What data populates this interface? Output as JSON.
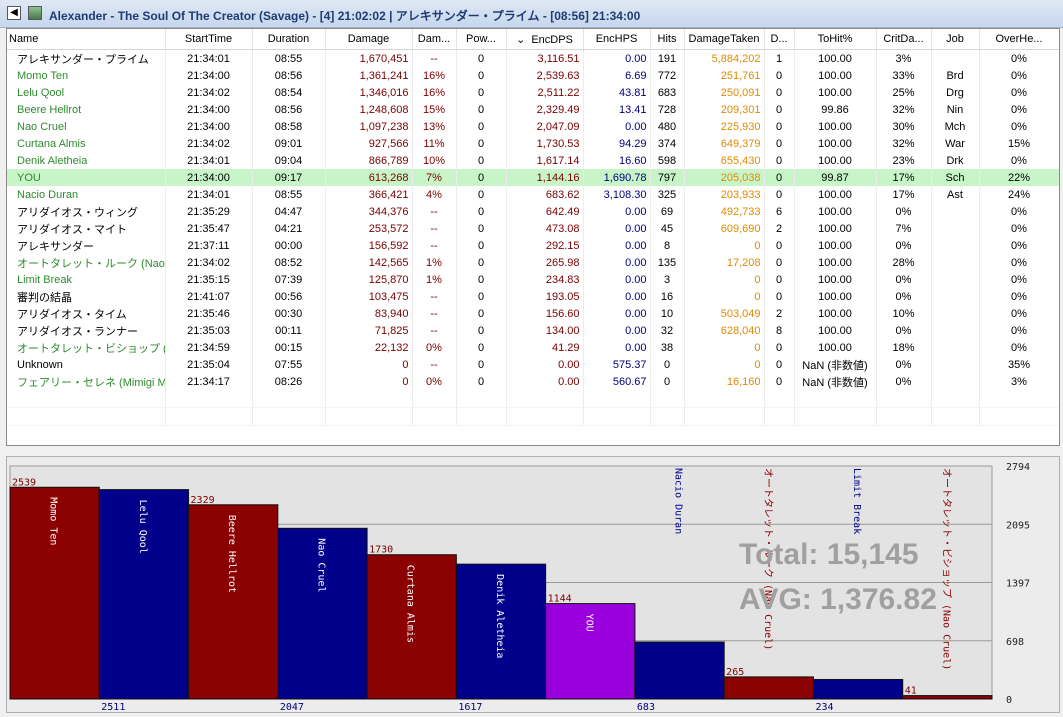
{
  "window": {
    "title": "Alexander - The Soul Of The Creator (Savage) - [4] 21:02:02 | アレキサンダー・プライム - [08:56] 21:34:00"
  },
  "table": {
    "columns": [
      {
        "key": "name",
        "label": "Name"
      },
      {
        "key": "start",
        "label": "StartTime"
      },
      {
        "key": "dur",
        "label": "Duration"
      },
      {
        "key": "dmg",
        "label": "Damage"
      },
      {
        "key": "dmgp",
        "label": "Dam..."
      },
      {
        "key": "pow",
        "label": "Pow..."
      },
      {
        "key": "encdps",
        "label": "EncDPS",
        "sort": "⌄"
      },
      {
        "key": "enchps",
        "label": "EncHPS"
      },
      {
        "key": "hits",
        "label": "Hits"
      },
      {
        "key": "taken",
        "label": "DamageTaken"
      },
      {
        "key": "d",
        "label": "D..."
      },
      {
        "key": "tohit",
        "label": "ToHit%"
      },
      {
        "key": "crit",
        "label": "CritDa..."
      },
      {
        "key": "job",
        "label": "Job"
      },
      {
        "key": "over",
        "label": "OverHe..."
      }
    ],
    "rows": [
      {
        "name": "アレキサンダー・プライム",
        "start": "21:34:01",
        "dur": "08:55",
        "dmg": "1,670,451",
        "dmgp": "--",
        "pow": "0",
        "encdps": "3,116.51",
        "enchps": "0.00",
        "hits": "191",
        "taken": "5,884,202",
        "d": "1",
        "tohit": "100.00",
        "crit": "3%",
        "job": "",
        "over": "0%",
        "color": "black"
      },
      {
        "name": "Momo Ten",
        "start": "21:34:00",
        "dur": "08:56",
        "dmg": "1,361,241",
        "dmgp": "16%",
        "pow": "0",
        "encdps": "2,539.63",
        "enchps": "6.69",
        "hits": "772",
        "taken": "251,761",
        "d": "0",
        "tohit": "100.00",
        "crit": "33%",
        "job": "Brd",
        "over": "0%",
        "color": "green"
      },
      {
        "name": "Lelu Qool",
        "start": "21:34:02",
        "dur": "08:54",
        "dmg": "1,346,016",
        "dmgp": "16%",
        "pow": "0",
        "encdps": "2,511.22",
        "enchps": "43.81",
        "hits": "683",
        "taken": "250,091",
        "d": "0",
        "tohit": "100.00",
        "crit": "25%",
        "job": "Drg",
        "over": "0%",
        "color": "green"
      },
      {
        "name": "Beere Hellrot",
        "start": "21:34:00",
        "dur": "08:56",
        "dmg": "1,248,608",
        "dmgp": "15%",
        "pow": "0",
        "encdps": "2,329.49",
        "enchps": "13.41",
        "hits": "728",
        "taken": "209,301",
        "d": "0",
        "tohit": "99.86",
        "crit": "32%",
        "job": "Nin",
        "over": "0%",
        "color": "green"
      },
      {
        "name": "Nao Cruel",
        "start": "21:34:00",
        "dur": "08:58",
        "dmg": "1,097,238",
        "dmgp": "13%",
        "pow": "0",
        "encdps": "2,047.09",
        "enchps": "0.00",
        "hits": "480",
        "taken": "225,930",
        "d": "0",
        "tohit": "100.00",
        "crit": "30%",
        "job": "Mch",
        "over": "0%",
        "color": "green"
      },
      {
        "name": "Curtana Almis",
        "start": "21:34:02",
        "dur": "09:01",
        "dmg": "927,566",
        "dmgp": "11%",
        "pow": "0",
        "encdps": "1,730.53",
        "enchps": "94.29",
        "hits": "374",
        "taken": "649,379",
        "d": "0",
        "tohit": "100.00",
        "crit": "32%",
        "job": "War",
        "over": "15%",
        "color": "green"
      },
      {
        "name": "Denik Aletheia",
        "start": "21:34:01",
        "dur": "09:04",
        "dmg": "866,789",
        "dmgp": "10%",
        "pow": "0",
        "encdps": "1,617.14",
        "enchps": "16.60",
        "hits": "598",
        "taken": "655,430",
        "d": "0",
        "tohit": "100.00",
        "crit": "23%",
        "job": "Drk",
        "over": "0%",
        "color": "green"
      },
      {
        "name": "YOU",
        "start": "21:34:00",
        "dur": "09:17",
        "dmg": "613,268",
        "dmgp": "7%",
        "pow": "0",
        "encdps": "1,144.16",
        "enchps": "1,690.78",
        "hits": "797",
        "taken": "205,038",
        "d": "0",
        "tohit": "99.87",
        "crit": "17%",
        "job": "Sch",
        "over": "22%",
        "color": "green",
        "you": true
      },
      {
        "name": "Nacio Duran",
        "start": "21:34:01",
        "dur": "08:55",
        "dmg": "366,421",
        "dmgp": "4%",
        "pow": "0",
        "encdps": "683.62",
        "enchps": "3,108.30",
        "hits": "325",
        "taken": "203,933",
        "d": "0",
        "tohit": "100.00",
        "crit": "17%",
        "job": "Ast",
        "over": "24%",
        "color": "green"
      },
      {
        "name": "アリダイオス・ウィング",
        "start": "21:35:29",
        "dur": "04:47",
        "dmg": "344,376",
        "dmgp": "--",
        "pow": "0",
        "encdps": "642.49",
        "enchps": "0.00",
        "hits": "69",
        "taken": "492,733",
        "d": "6",
        "tohit": "100.00",
        "crit": "0%",
        "job": "",
        "over": "0%",
        "color": "black"
      },
      {
        "name": "アリダイオス・マイト",
        "start": "21:35:47",
        "dur": "04:21",
        "dmg": "253,572",
        "dmgp": "--",
        "pow": "0",
        "encdps": "473.08",
        "enchps": "0.00",
        "hits": "45",
        "taken": "609,690",
        "d": "2",
        "tohit": "100.00",
        "crit": "7%",
        "job": "",
        "over": "0%",
        "color": "black"
      },
      {
        "name": "アレキサンダー",
        "start": "21:37:11",
        "dur": "00:00",
        "dmg": "156,592",
        "dmgp": "--",
        "pow": "0",
        "encdps": "292.15",
        "enchps": "0.00",
        "hits": "8",
        "taken": "0",
        "d": "0",
        "tohit": "100.00",
        "crit": "0%",
        "job": "",
        "over": "0%",
        "color": "black"
      },
      {
        "name": "オートタレット・ルーク (Nao Cr...",
        "start": "21:34:02",
        "dur": "08:52",
        "dmg": "142,565",
        "dmgp": "1%",
        "pow": "0",
        "encdps": "265.98",
        "enchps": "0.00",
        "hits": "135",
        "taken": "17,208",
        "d": "0",
        "tohit": "100.00",
        "crit": "28%",
        "job": "",
        "over": "0%",
        "color": "green"
      },
      {
        "name": "Limit Break",
        "start": "21:35:15",
        "dur": "07:39",
        "dmg": "125,870",
        "dmgp": "1%",
        "pow": "0",
        "encdps": "234.83",
        "enchps": "0.00",
        "hits": "3",
        "taken": "0",
        "d": "0",
        "tohit": "100.00",
        "crit": "0%",
        "job": "",
        "over": "0%",
        "color": "green"
      },
      {
        "name": "審判の結晶",
        "start": "21:41:07",
        "dur": "00:56",
        "dmg": "103,475",
        "dmgp": "--",
        "pow": "0",
        "encdps": "193.05",
        "enchps": "0.00",
        "hits": "16",
        "taken": "0",
        "d": "0",
        "tohit": "100.00",
        "crit": "0%",
        "job": "",
        "over": "0%",
        "color": "black"
      },
      {
        "name": "アリダイオス・タイム",
        "start": "21:35:46",
        "dur": "00:30",
        "dmg": "83,940",
        "dmgp": "--",
        "pow": "0",
        "encdps": "156.60",
        "enchps": "0.00",
        "hits": "10",
        "taken": "503,049",
        "d": "2",
        "tohit": "100.00",
        "crit": "10%",
        "job": "",
        "over": "0%",
        "color": "black"
      },
      {
        "name": "アリダイオス・ランナー",
        "start": "21:35:03",
        "dur": "00:11",
        "dmg": "71,825",
        "dmgp": "--",
        "pow": "0",
        "encdps": "134.00",
        "enchps": "0.00",
        "hits": "32",
        "taken": "628,040",
        "d": "8",
        "tohit": "100.00",
        "crit": "0%",
        "job": "",
        "over": "0%",
        "color": "black"
      },
      {
        "name": "オートタレット・ビショップ (Nao ...",
        "start": "21:34:59",
        "dur": "00:15",
        "dmg": "22,132",
        "dmgp": "0%",
        "pow": "0",
        "encdps": "41.29",
        "enchps": "0.00",
        "hits": "38",
        "taken": "0",
        "d": "0",
        "tohit": "100.00",
        "crit": "18%",
        "job": "",
        "over": "0%",
        "color": "green"
      },
      {
        "name": "Unknown",
        "start": "21:35:04",
        "dur": "07:55",
        "dmg": "0",
        "dmgp": "--",
        "pow": "0",
        "encdps": "0.00",
        "enchps": "575.37",
        "hits": "0",
        "taken": "0",
        "d": "0",
        "tohit": "NaN (非数値)",
        "crit": "0%",
        "job": "",
        "over": "35%",
        "color": "black"
      },
      {
        "name": "フェアリー・セレネ (Mimigi Migi)",
        "start": "21:34:17",
        "dur": "08:26",
        "dmg": "0",
        "dmgp": "0%",
        "pow": "0",
        "encdps": "0.00",
        "enchps": "560.67",
        "hits": "0",
        "taken": "16,160",
        "d": "0",
        "tohit": "NaN (非数値)",
        "crit": "0%",
        "job": "",
        "over": "3%",
        "color": "green"
      }
    ]
  },
  "colors": {
    "green_text": "#2e8b2e",
    "damage_text": "#7a0000",
    "enchps_text": "#00007a",
    "taken_text": "#e08a00",
    "you_row": "#c8f5c8",
    "bar_red": "#8b0000",
    "bar_blue": "#00008b",
    "bar_purple": "#9a00dd",
    "overlay_text": "#a0a0a0"
  },
  "chart_data": {
    "type": "bar",
    "categories": [
      "Momo Ten",
      "Lelu Qool",
      "Beere Hellrot",
      "Nao Cruel",
      "Curtana Almis",
      "Denik Aletheia",
      "YOU",
      "Nacio Duran",
      "オートタレット・ルーク (Nao Cruel)",
      "Limit Break",
      "オートタレット・ビショップ (Nao Cruel)"
    ],
    "values": [
      2539,
      2511,
      2329,
      2047,
      1730,
      1617,
      1144,
      683,
      265,
      234,
      41
    ],
    "value_labels": [
      "2539",
      "2511",
      "2329",
      "2047",
      "1730",
      "1617",
      "1144",
      "683",
      "265",
      "234",
      "41"
    ],
    "colors": [
      "#8b0000",
      "#00008b",
      "#8b0000",
      "#00008b",
      "#8b0000",
      "#00008b",
      "#9a00dd",
      "#00008b",
      "#8b0000",
      "#00008b",
      "#8b0000"
    ],
    "ylim": [
      0,
      2794
    ],
    "yticks": [
      0,
      698,
      1397,
      2095,
      2794
    ],
    "total_text": "Total: 15,145",
    "avg_text": "AVG: 1,376.82"
  }
}
